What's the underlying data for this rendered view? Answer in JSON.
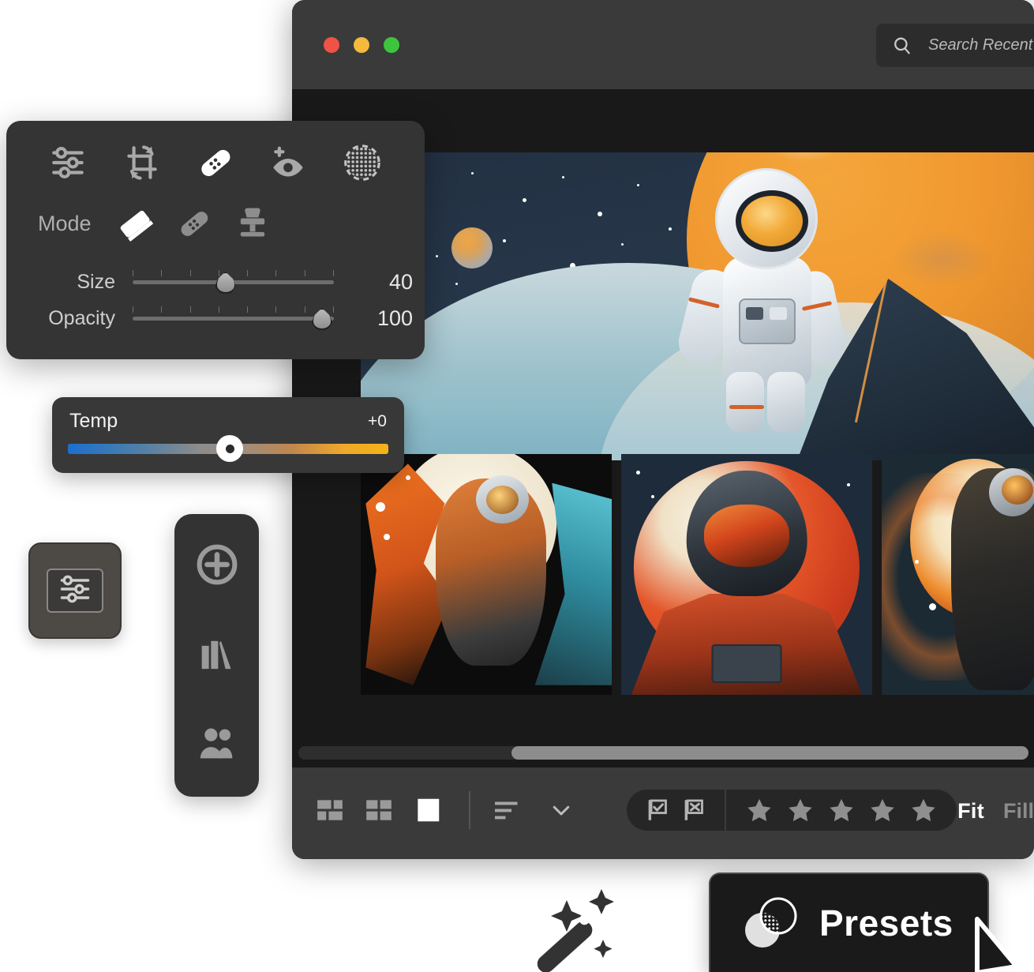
{
  "window": {
    "traffic_lights": [
      "close",
      "minimize",
      "zoom"
    ],
    "colors": {
      "close": "#ef5346",
      "minimize": "#f4b93d",
      "zoom": "#3dc63d"
    }
  },
  "search": {
    "placeholder": "Search Recent Import",
    "value": "",
    "icon": "search-icon"
  },
  "filter_button": {
    "icon": "filter-funnel-icon",
    "label": ""
  },
  "heal_panel": {
    "tools": [
      {
        "name": "adjust-sliders-icon",
        "active": false
      },
      {
        "name": "crop-rotate-icon",
        "active": false
      },
      {
        "name": "healing-bandage-icon",
        "active": true
      },
      {
        "name": "red-eye-icon",
        "active": false
      },
      {
        "name": "dot-grid-circle-icon",
        "active": false
      }
    ],
    "mode_label": "Mode",
    "modes": [
      {
        "name": "eraser-icon",
        "active": true
      },
      {
        "name": "bandage-icon",
        "active": false
      },
      {
        "name": "clone-stamp-icon",
        "active": false
      }
    ],
    "sliders": [
      {
        "label": "Size",
        "value": "40",
        "percent": 45
      },
      {
        "label": "Opacity",
        "value": "100",
        "percent": 96
      }
    ]
  },
  "temp_panel": {
    "label": "Temp",
    "value": "+0",
    "thumb_percent": 48,
    "gradient_from": "#1b6fd0",
    "gradient_to": "#f2b318"
  },
  "adjust_button": {
    "icon": "adjust-sliders-icon"
  },
  "rail": {
    "items": [
      {
        "name": "add-circle-icon"
      },
      {
        "name": "books-library-icon"
      },
      {
        "name": "people-group-icon"
      }
    ]
  },
  "gallery": {
    "main_image_alt": "Astronaut in white suit with orange visor before a large orange planet, blue clouds and dark mountain",
    "thumbnails": [
      {
        "alt": "Astronaut in orange suit floating before white moon with orange and teal swirls"
      },
      {
        "alt": "Front-facing astronaut portrait in red suit with dark helmet before a red planet"
      },
      {
        "alt": "Dark-suited astronaut floating past an orange and white moon"
      }
    ]
  },
  "scrollbar": {
    "thumb_start_percent": 29,
    "thumb_width_percent": 71
  },
  "bottom_toolbar": {
    "views": [
      {
        "name": "masonry-grid-view-icon",
        "active": false
      },
      {
        "name": "grid-view-icon",
        "active": false
      },
      {
        "name": "single-view-icon",
        "active": true
      }
    ],
    "sort": {
      "icon": "sort-lines-icon",
      "chevron": "chevron-down-icon"
    },
    "flags": [
      {
        "name": "flag-pick-icon"
      },
      {
        "name": "flag-reject-icon"
      }
    ],
    "rating": {
      "stars": 5,
      "filled": 0
    },
    "zoom_modes": [
      {
        "label": "Fit",
        "active": true
      },
      {
        "label": "Fill",
        "active": false
      }
    ]
  },
  "wand": {
    "icon": "magic-wand-sparkles-icon"
  },
  "presets": {
    "label": "Presets",
    "icon": "presets-circles-icon"
  },
  "cursor": {
    "icon": "mouse-pointer-arrow"
  }
}
